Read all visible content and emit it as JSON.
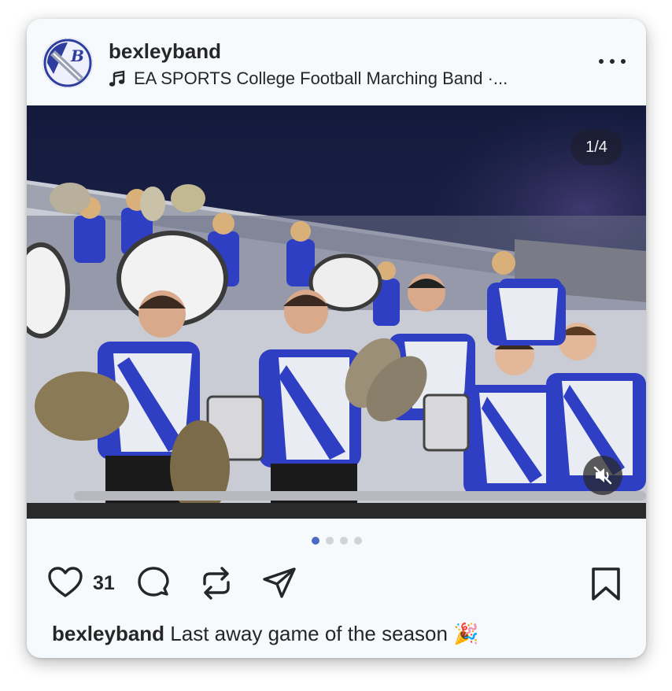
{
  "post": {
    "username": "bexleyband",
    "audio_text": "EA SPORTS College Football Marching Band ·...",
    "media_counter": "1/4",
    "carousel": {
      "total": 4,
      "active": 1
    },
    "likes_count": "31",
    "caption_user": "bexleyband",
    "caption_text": "Last away game of the season",
    "caption_emoji": "🎉"
  },
  "icons": {
    "avatar": "bexley-b-logo",
    "audio": "music-note-icon",
    "more": "more-options-icon",
    "mute": "speaker-muted-icon",
    "like": "heart-icon",
    "comment": "comment-bubble-icon",
    "repost": "repost-icon",
    "share": "paper-plane-icon",
    "save": "bookmark-icon"
  },
  "colors": {
    "text": "#262626",
    "card_bg": "#f7fafc",
    "active_dot": "#4a6cc4",
    "inactive_dot": "#d0d4d9",
    "uniform_blue": "#2f3fc4"
  }
}
